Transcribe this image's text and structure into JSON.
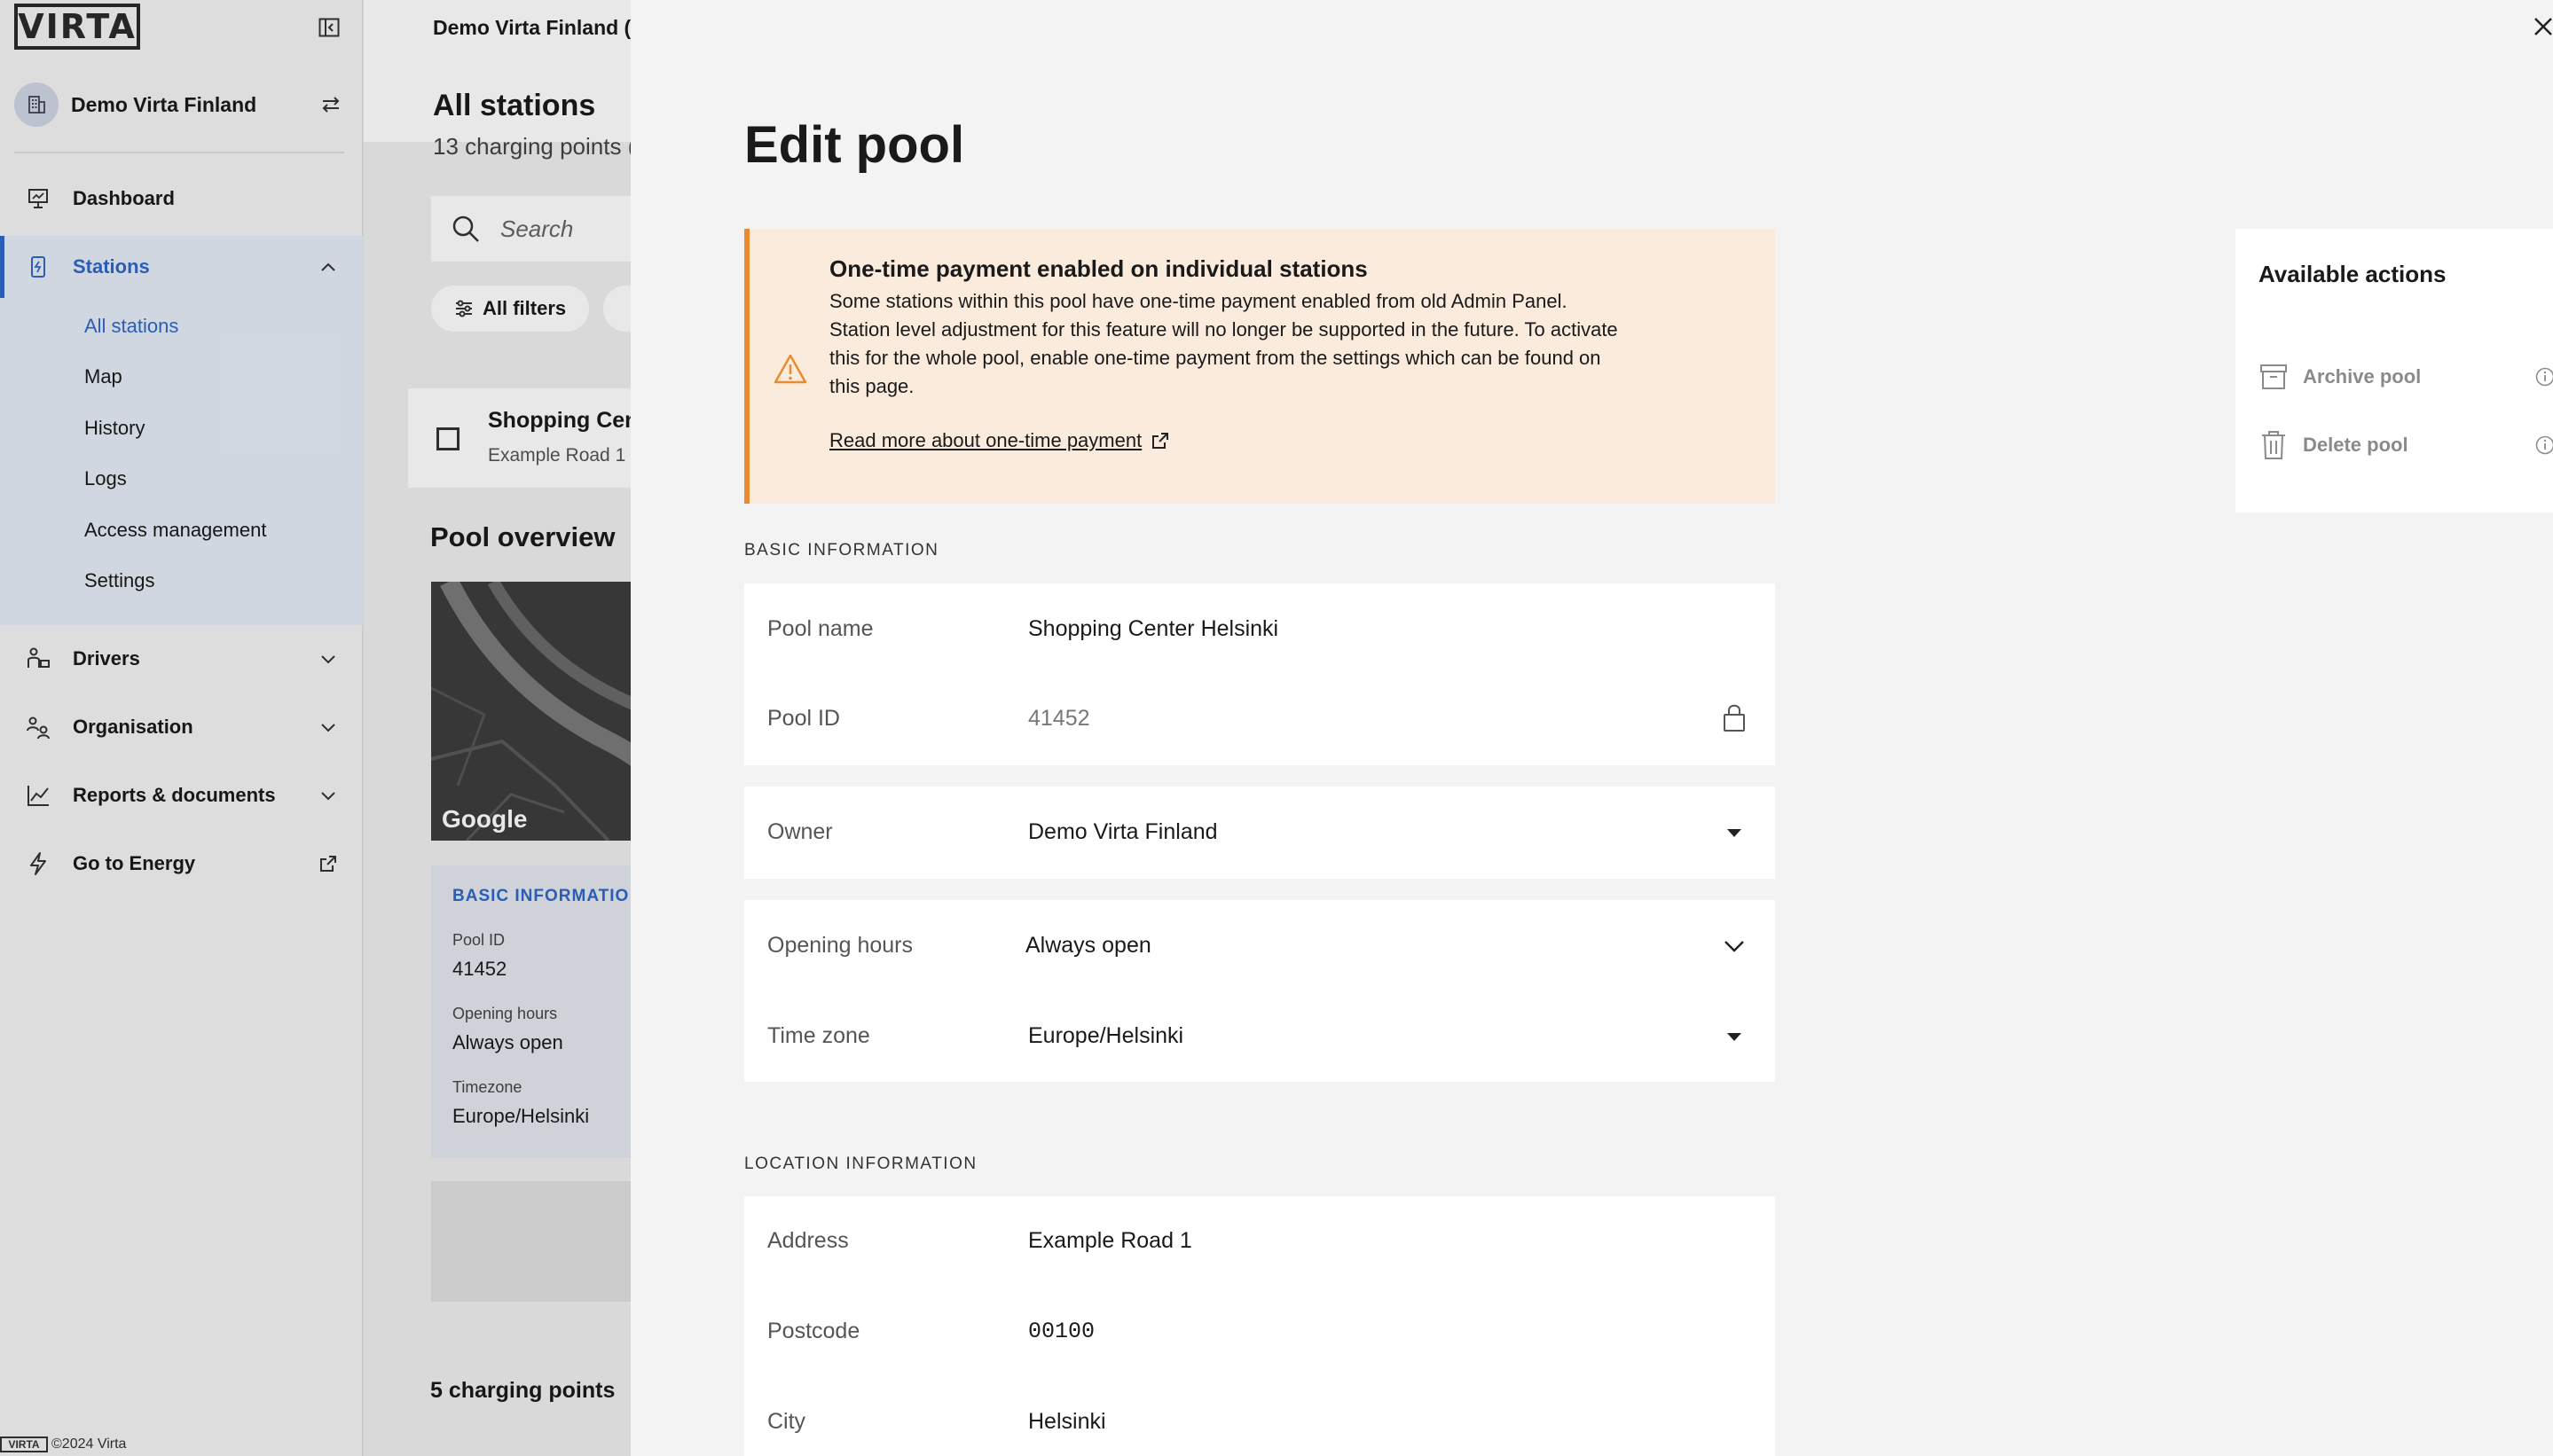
{
  "brand": {
    "logo_text": "VIRTA",
    "accent_color": "#2f67c9"
  },
  "sidebar": {
    "org_name": "Demo Virta Finland",
    "nav": [
      {
        "label": "Dashboard",
        "icon": "dashboard-icon"
      },
      {
        "label": "Stations",
        "icon": "station-icon",
        "expanded": true,
        "active": true
      },
      {
        "label": "Drivers",
        "icon": "drivers-icon"
      },
      {
        "label": "Organisation",
        "icon": "organisation-icon"
      },
      {
        "label": "Reports & documents",
        "icon": "reports-icon"
      },
      {
        "label": "Go to Energy",
        "icon": "energy-icon",
        "external": true
      }
    ],
    "stations_sub": [
      "All stations",
      "Map",
      "History",
      "Logs",
      "Access management",
      "Settings"
    ],
    "copyright": "©2024 Virta"
  },
  "background": {
    "breadcrumb": "Demo Virta Finland (I",
    "title": "All stations",
    "subtitle": "13 charging points (",
    "search_placeholder": "Search",
    "filters_label": "All filters",
    "card_title": "Shopping Cen",
    "card_sub": "Example Road 1",
    "pool_overview": "Pool overview",
    "map_brand": "Google",
    "basic_title": "BASIC INFORMATIO",
    "pool_id_label": "Pool ID",
    "pool_id_value": "41452",
    "opening_hours_label": "Opening hours",
    "opening_hours_value": "Always open",
    "timezone_label": "Timezone",
    "timezone_value": "Europe/Helsinki",
    "charging_points": "5 charging points"
  },
  "drawer": {
    "title": "Edit pool",
    "alert": {
      "title": "One-time payment enabled on individual stations",
      "body": "Some stations within this pool have one-time payment enabled from old Admin Panel. Station level adjustment for this feature will no longer be supported in the future. To activate this for the whole pool, enable one-time payment from the settings which can be found on this page.",
      "link": "Read more about one-time payment",
      "color": "#e98a2e"
    },
    "basic_section": "BASIC INFORMATION",
    "fields": {
      "pool_name": {
        "label": "Pool name",
        "value": "Shopping Center Helsinki"
      },
      "pool_id": {
        "label": "Pool ID",
        "value": "41452",
        "locked": true
      },
      "owner": {
        "label": "Owner",
        "value": "Demo Virta Finland"
      },
      "opening_hours": {
        "label": "Opening hours",
        "value": "Always open"
      },
      "time_zone": {
        "label": "Time zone",
        "value": "Europe/Helsinki"
      }
    },
    "location_section": "LOCATION INFORMATION",
    "location": {
      "address": {
        "label": "Address",
        "value": "Example Road 1"
      },
      "postcode": {
        "label": "Postcode",
        "value": "00100"
      },
      "city": {
        "label": "City",
        "value": "Helsinki"
      }
    },
    "actions": {
      "title": "Available actions",
      "archive": "Archive pool",
      "delete": "Delete pool"
    }
  }
}
